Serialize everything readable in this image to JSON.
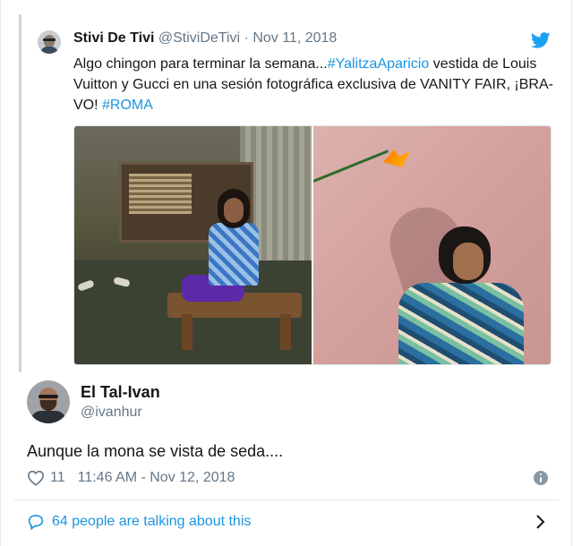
{
  "quoted_tweet": {
    "name": "Stivi De Tivi",
    "handle": "@StiviDeTivi",
    "separator": "·",
    "date": "Nov 11, 2018",
    "text_before": "Algo chingon para terminar la semana...",
    "hashtag1": "#YalitzaAparicio",
    "text_middle": " vestida de Louis Vuitton y Gucci en una sesión fotográfica exclusiva de VANITY FAIR, ¡BRA-VO! ",
    "hashtag2": "#ROMA"
  },
  "reply": {
    "name": "El Tal-Ivan",
    "handle": "@ivanhur",
    "text": "Aunque la mona se vista de seda....",
    "likes": "11",
    "timestamp": "11:46 AM - Nov 12, 2018"
  },
  "footer": {
    "talking_text": "64 people are talking about this"
  },
  "colors": {
    "link": "#1b95e0",
    "muted": "#657786",
    "text": "#14171a",
    "border": "#e1e8ed"
  },
  "icons": {
    "bird": "twitter-bird-icon",
    "heart": "heart-icon",
    "info": "info-icon",
    "bubble": "speech-bubble-icon",
    "chevron": "chevron-right-icon"
  }
}
